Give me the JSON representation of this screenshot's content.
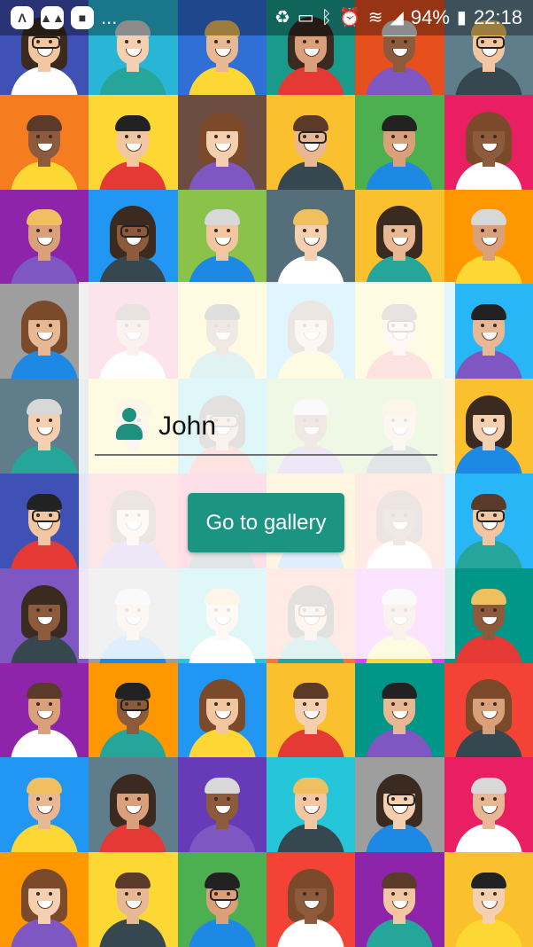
{
  "status_bar": {
    "left_icons": [
      "app-a-icon",
      "app-m-icon",
      "bag-icon"
    ],
    "overflow": "...",
    "right_icons": [
      "recycle-icon",
      "cast-icon",
      "bluetooth-icon",
      "alarm-icon",
      "wifi-icon",
      "signal-icon"
    ],
    "battery": "94%",
    "time": "22:18"
  },
  "form": {
    "name_value": "John",
    "person_icon": "person-icon"
  },
  "button": {
    "label": "Go to gallery"
  },
  "colors": {
    "accent": "#1b9483",
    "tiles": [
      [
        "#3f51b5",
        "#29b6d6",
        "#2f6fd6",
        "#1a9a8a",
        "#e6501e",
        "#607d8b"
      ],
      [
        "#f57c1f",
        "#fdd835",
        "#6d4c41",
        "#fbc02d",
        "#4caf50",
        "#e91e63"
      ],
      [
        "#8e24aa",
        "#2196f3",
        "#8bc34a",
        "#546e7a",
        "#fbc02d",
        "#ff9800"
      ],
      [
        "#9e9e9e",
        "#ec407a",
        "#fdd835",
        "#29b6f6",
        "#fdd835",
        "#29b6f6"
      ],
      [
        "#607d8b",
        "#fdd835",
        "#26c6da",
        "#8bc34a",
        "#8bc34a",
        "#fbc02d"
      ],
      [
        "#3f51b5",
        "#ef5350",
        "#e91e63",
        "#fbc02d",
        "#ff7043",
        "#29b6f6"
      ],
      [
        "#7e57c2",
        "#9e9e9e",
        "#26c6da",
        "#ff7043",
        "#e040fb",
        "#009688"
      ],
      [
        "#8e24aa",
        "#ff9800",
        "#2196f3",
        "#fbc02d",
        "#009688",
        "#f44336"
      ],
      [
        "#2196f3",
        "#607d8b",
        "#673ab7",
        "#26c6da",
        "#9e9e9e",
        "#e91e63"
      ],
      [
        "#ff9800",
        "#fdd835",
        "#4caf50",
        "#f44336",
        "#8e24aa",
        "#fbc02d"
      ]
    ]
  }
}
